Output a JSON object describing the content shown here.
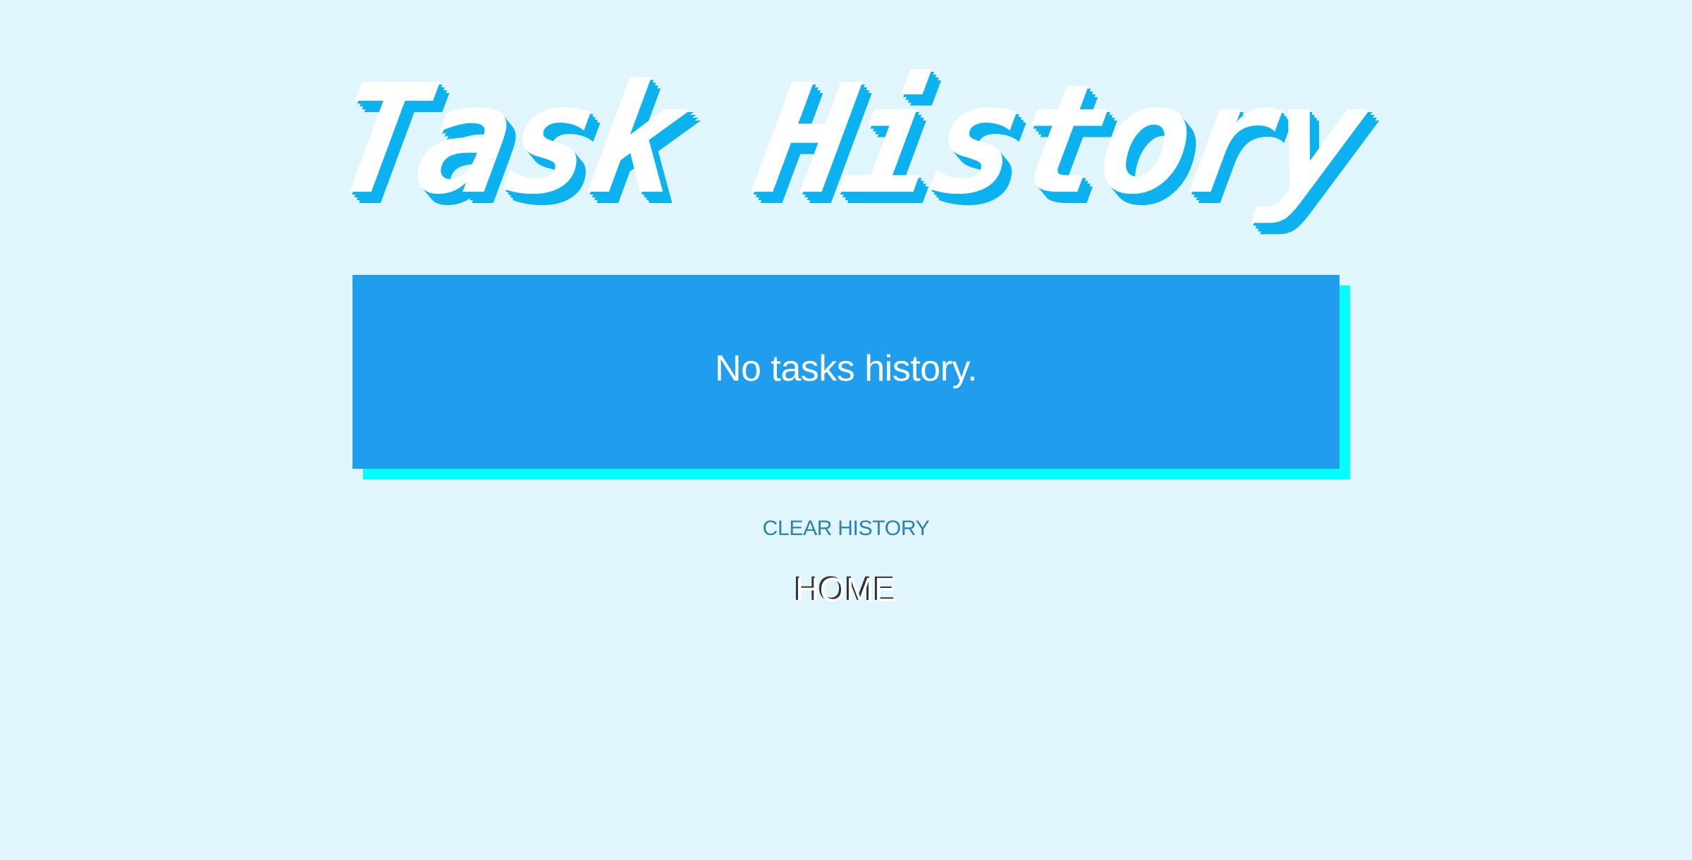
{
  "header": {
    "title": "Task History"
  },
  "history": {
    "empty_message": "No tasks history."
  },
  "actions": {
    "clear_label": "CLEAR HISTORY",
    "home_label": "HOME"
  },
  "colors": {
    "background": "#e0f5fc",
    "title_text": "#ffffff",
    "title_shadow": "#0cb2f0",
    "card": "#209ded",
    "card_shadow": "#00ffff",
    "clear_link": "#2a80b9",
    "home_shadow": "#333333"
  }
}
